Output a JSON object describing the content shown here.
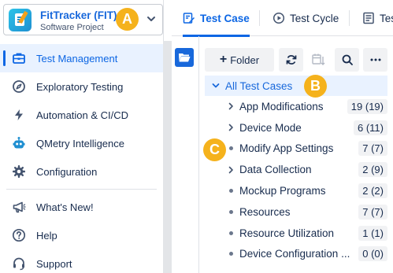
{
  "project": {
    "name": "FitTracker (FIT)",
    "type": "Software Project",
    "icon": "qmetry-project-logo"
  },
  "callouts": [
    "A",
    "B",
    "C"
  ],
  "sidebar": {
    "items": [
      {
        "label": "Test Management",
        "icon": "briefcase-icon",
        "active": true
      },
      {
        "label": "Exploratory Testing",
        "icon": "compass-icon"
      },
      {
        "label": "Automation & CI/CD",
        "icon": "lightning-icon"
      },
      {
        "label": "QMetry Intelligence",
        "icon": "robot-icon"
      },
      {
        "label": "Configuration",
        "icon": "gear-icon"
      }
    ],
    "bottom_items": [
      {
        "label": "What's New!",
        "icon": "megaphone-icon"
      },
      {
        "label": "Help",
        "icon": "help-icon"
      },
      {
        "label": "Support",
        "icon": "support-icon"
      }
    ]
  },
  "tabs": [
    {
      "label": "Test Case",
      "icon": "edit-doc-icon",
      "active": true
    },
    {
      "label": "Test Cycle",
      "icon": "play-circle-icon"
    },
    {
      "label": "Tes",
      "icon": "list-doc-icon"
    }
  ],
  "toolbar": {
    "folder_label": "Folder"
  },
  "tree": {
    "root_label": "All Test Cases",
    "items": [
      {
        "label": "App Modifications",
        "count": "19 (19)",
        "expandable": true
      },
      {
        "label": "Device Mode",
        "count": "6 (11)",
        "expandable": true
      },
      {
        "label": "Modify App Settings",
        "count": "7 (7)",
        "expandable": false
      },
      {
        "label": "Data Collection",
        "count": "2 (9)",
        "expandable": true
      },
      {
        "label": "Mockup Programs",
        "count": "2 (2)",
        "expandable": false
      },
      {
        "label": "Resources",
        "count": "7 (7)",
        "expandable": false
      },
      {
        "label": "Resource Utilization",
        "count": "1 (1)",
        "expandable": false
      },
      {
        "label": "Device Configuration ...",
        "count": "0 (0)",
        "expandable": false
      }
    ]
  },
  "colors": {
    "accent": "#0c66e4",
    "callout": "#f5b21c",
    "active_bg": "#e9f2ff"
  }
}
